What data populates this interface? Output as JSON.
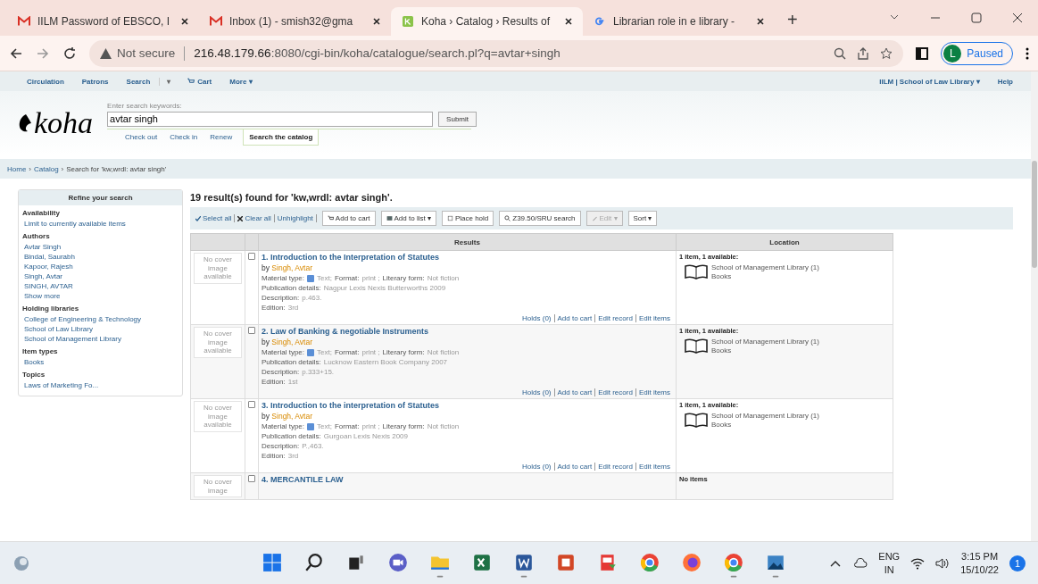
{
  "browser": {
    "tabs": [
      {
        "title": "IILM Password of EBSCO, I",
        "selected": false
      },
      {
        "title": "Inbox (1) - smish32@gma",
        "selected": false
      },
      {
        "title": "Koha › Catalog › Results of",
        "selected": true
      },
      {
        "title": "Librarian role in e library -",
        "selected": false
      }
    ],
    "new_tab": "+",
    "security": "Not secure",
    "url_host": "216.48.179.66",
    "url_rest": ":8080/cgi-bin/koha/catalogue/search.pl?q=avtar+singh",
    "profile_initial": "L",
    "profile_status": "Paused"
  },
  "koha": {
    "nav": [
      {
        "label": "Circulation",
        "kind": "link"
      },
      {
        "label": "Patrons",
        "kind": "link"
      },
      {
        "label": "Search",
        "kind": "link"
      },
      {
        "label": "▾",
        "kind": "dropdown"
      },
      {
        "label": "Cart",
        "kind": "cart"
      },
      {
        "label": "More ▾",
        "kind": "link"
      }
    ],
    "nav_right": [
      "IILM | School of Law Library ▾",
      "Help"
    ],
    "logo": "koha",
    "search_label": "Enter search keywords:",
    "search_value": "avtar singh",
    "submit": "Submit",
    "search_tabs": [
      {
        "label": "Check out",
        "selected": false
      },
      {
        "label": "Check in",
        "selected": false
      },
      {
        "label": "Renew",
        "selected": false
      },
      {
        "label": "Search the catalog",
        "selected": true
      }
    ],
    "breadcrumb": {
      "separator": "›",
      "items": [
        "Home",
        "Catalog",
        "Search for 'kw,wrdl: avtar singh'"
      ]
    }
  },
  "sidebar": {
    "title": "Refine your search",
    "groups": [
      {
        "heading": "Availability",
        "items": [
          "Limit to currently available items"
        ]
      },
      {
        "heading": "Authors",
        "items": [
          "Avtar Singh",
          "Bindal, Saurabh",
          "Kapoor, Rajesh",
          "Singh, Avtar",
          "SINGH, AVTAR",
          "Show more"
        ]
      },
      {
        "heading": "Holding libraries",
        "items": [
          "College of Engineering & Technology",
          "School of Law Library",
          "School of Management Library"
        ]
      },
      {
        "heading": "Item types",
        "items": [
          "Books"
        ]
      },
      {
        "heading": "Topics",
        "items": [
          "Laws of Marketing Fo..."
        ]
      }
    ]
  },
  "results": {
    "heading": "19 result(s) found for 'kw,wrdl: avtar singh'.",
    "selection_links": [
      {
        "label": "Select all",
        "kind": "check"
      },
      {
        "label": "Clear all",
        "kind": "cross"
      },
      {
        "label": "Unhighlight",
        "kind": "plain"
      }
    ],
    "toolbar": [
      {
        "label": "Add to cart",
        "kind": "cart",
        "disabled": false
      },
      {
        "label": "Add to list ▾",
        "kind": "list",
        "disabled": false
      },
      {
        "label": "Place hold",
        "kind": "hold",
        "disabled": false
      },
      {
        "label": "Z39.50/SRU search",
        "kind": "search",
        "disabled": false
      },
      {
        "label": "Edit ▾",
        "kind": "edit",
        "disabled": true
      },
      {
        "label": "Sort ▾",
        "kind": "plain",
        "disabled": false
      }
    ],
    "columns": [
      "Results",
      "Location"
    ],
    "records": [
      {
        "cover": "No cover image available",
        "checked": false,
        "number": "1.",
        "title": "Introduction to the Interpretation of Statutes",
        "by": "by",
        "author": "Singh, Avtar",
        "fields": [
          {
            "label": "Material type:",
            "value": "Text;"
          },
          {
            "label": "Format:",
            "value": "print ;"
          },
          {
            "label": "Literary form:",
            "value": "Not fiction"
          }
        ],
        "details": [
          {
            "label": "Publication details:",
            "value": "Nagpur Lexis Nexis Butterworths 2009"
          },
          {
            "label": "Description:",
            "value": "p.463."
          },
          {
            "label": "Edition:",
            "value": "3rd"
          }
        ],
        "actions": [
          "Holds (0)",
          "Add to cart",
          "Edit record",
          "Edit items"
        ],
        "availability": "1 item, 1 available:",
        "library": "School of Management Library (1)",
        "item_type": "Books"
      },
      {
        "cover": "No cover image available",
        "checked": false,
        "number": "2.",
        "title": "Law of Banking & negotiable Instruments",
        "by": "by",
        "author": "Singh, Avtar",
        "fields": [
          {
            "label": "Material type:",
            "value": "Text;"
          },
          {
            "label": "Format:",
            "value": "print ;"
          },
          {
            "label": "Literary form:",
            "value": "Not fiction"
          }
        ],
        "details": [
          {
            "label": "Publication details:",
            "value": "Lucknow Eastern Book Company 2007"
          },
          {
            "label": "Description:",
            "value": "p.333+15."
          },
          {
            "label": "Edition:",
            "value": "1st"
          }
        ],
        "actions": [
          "Holds (0)",
          "Add to cart",
          "Edit record",
          "Edit items"
        ],
        "availability": "1 item, 1 available:",
        "library": "School of Management Library (1)",
        "item_type": "Books"
      },
      {
        "cover": "No cover image available",
        "checked": false,
        "number": "3.",
        "title": "Introduction to the interpretation of Statutes",
        "by": "by",
        "author": "Singh, Avtar",
        "fields": [
          {
            "label": "Material type:",
            "value": "Text;"
          },
          {
            "label": "Format:",
            "value": "print ;"
          },
          {
            "label": "Literary form:",
            "value": "Not fiction"
          }
        ],
        "details": [
          {
            "label": "Publication details:",
            "value": "Gurgoan Lexis Nexis 2009"
          },
          {
            "label": "Description:",
            "value": "P.,463."
          },
          {
            "label": "Edition:",
            "value": "3rd"
          }
        ],
        "actions": [
          "Holds (0)",
          "Add to cart",
          "Edit record",
          "Edit items"
        ],
        "availability": "1 item, 1 available:",
        "library": "School of Management Library (1)",
        "item_type": "Books"
      },
      {
        "cover": "No cover image",
        "checked": false,
        "number": "4.",
        "title": "MERCANTILE LAW",
        "availability": "No items"
      }
    ]
  },
  "taskbar": {
    "apps": [
      {
        "kind": "start",
        "running": false
      },
      {
        "kind": "search",
        "running": false
      },
      {
        "kind": "taskview",
        "running": false
      },
      {
        "kind": "chat",
        "running": false
      },
      {
        "kind": "folder",
        "running": true
      },
      {
        "kind": "sheet",
        "running": false
      },
      {
        "kind": "doc",
        "running": true
      },
      {
        "kind": "slides",
        "running": false
      },
      {
        "kind": "pdf",
        "running": false
      },
      {
        "kind": "browser",
        "running": false
      },
      {
        "kind": "firefox",
        "running": false
      },
      {
        "kind": "browser",
        "running": true
      },
      {
        "kind": "photos",
        "running": true
      }
    ],
    "language": "ENG",
    "region": "IN",
    "time": "3:15 PM",
    "date": "15/10/22",
    "notifications": "1"
  }
}
